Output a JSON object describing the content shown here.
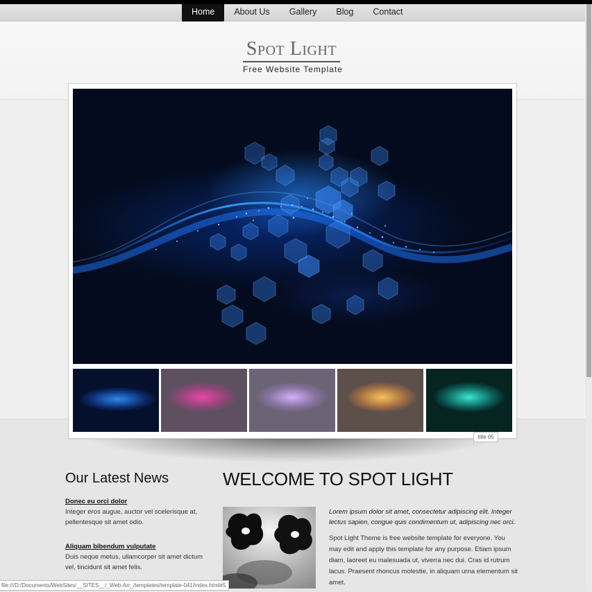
{
  "nav": {
    "items": [
      {
        "label": "Home",
        "active": true
      },
      {
        "label": "About Us",
        "active": false
      },
      {
        "label": "Gallery",
        "active": false
      },
      {
        "label": "Blog",
        "active": false
      },
      {
        "label": "Contact",
        "active": false
      }
    ]
  },
  "header": {
    "logo_title": "Spot Light",
    "logo_subtitle": "Free Website Template"
  },
  "slider": {
    "caption": "title 05",
    "thumbnails": [
      {
        "name": "blue",
        "color": "#1e6cff"
      },
      {
        "name": "pink",
        "color": "#e0409a"
      },
      {
        "name": "violet",
        "color": "#c7a6e8"
      },
      {
        "name": "orange",
        "color": "#ffb24a"
      },
      {
        "name": "teal",
        "color": "#27e0d4"
      }
    ]
  },
  "news": {
    "title": "Our Latest News",
    "items": [
      {
        "heading": "Donec eu orci dolor",
        "text": "Integer eros augue, auctor vel scelerisque at, pellentesque sit amet odio."
      },
      {
        "heading": "Aliquam bibendum vulputate",
        "text": "Duis neque metus, ullamcorper sit amet dictum vel, tincidunt sit amet felis."
      }
    ]
  },
  "main": {
    "title": "WELCOME TO SPOT LIGHT",
    "intro": "Lorem ipsum dolor sit amet, consectetur adipiscing elit. Integer lectus sapien, congue quis condimentum ut, adipiscing nec orci.",
    "body": "Spot Light Theme is free website template for everyone. You may edit and apply this template for any purpose. Etiam ipsum diam, laoreet eu malesuada ut, viverra nec dui. Cras id rutrum lacus. Praesent rhoncus molestie, in aliquam urna elementum sit amet."
  },
  "status_url": "file:///D:/Documents/WebSites/__SITES__/_Web-Arr_/templates/template-041/index.html#5",
  "colors": {
    "nav_active_bg": "#111111",
    "hero_bg": "#040b1e",
    "accent_blue": "#1e6cff"
  }
}
